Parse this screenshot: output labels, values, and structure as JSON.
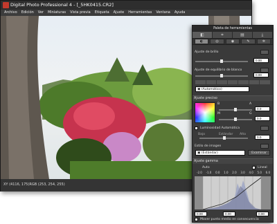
{
  "window": {
    "title": "Digital Photo Professional 4 - [_5HK0415.CR2]"
  },
  "menu": [
    "Archivo",
    "Edición",
    "Ver",
    "Miniaturas",
    "Vista previa",
    "Etiqueta",
    "Ajuste",
    "Herramientas",
    "Ventana",
    "Ayuda"
  ],
  "status": {
    "text": "XY (4116, 175)RGB (253, 254, 255)"
  },
  "palette": {
    "title": "Paleta de herramientas",
    "brightness": {
      "label": "Ajuste de brillo",
      "value": "0.00"
    },
    "wb": {
      "label": "Ajuste de equilibrio de blanco",
      "value": "0.00",
      "mode": "(Automático)"
    },
    "color": {
      "label": "Ajuste preciso",
      "b_label": "B",
      "a_label": "A",
      "m_label": "M",
      "g_label": "G",
      "value1": "0.0",
      "value2": "0.0",
      "value3": "0.0",
      "auto_label": "Luminosidad Automática",
      "min_label": "Bajo",
      "mid_label": "Estándar",
      "max_label": "Alto"
    },
    "style": {
      "label": "Estilo de imagen",
      "mode": "(Estándar)",
      "browse": "Examinar"
    },
    "gamma": {
      "label": "Ajuste gamma",
      "auto": "Auto",
      "linear": "Lineal",
      "ticks": [
        "-2.0",
        "-1.0",
        "0.0",
        "1.0",
        "2.0",
        "3.0",
        "4.0",
        "5.0",
        "6.0"
      ],
      "low": "0.00",
      "high": "0.00",
      "mid": "0.00",
      "move_label": "Mover punto medio en consecuencia"
    }
  }
}
